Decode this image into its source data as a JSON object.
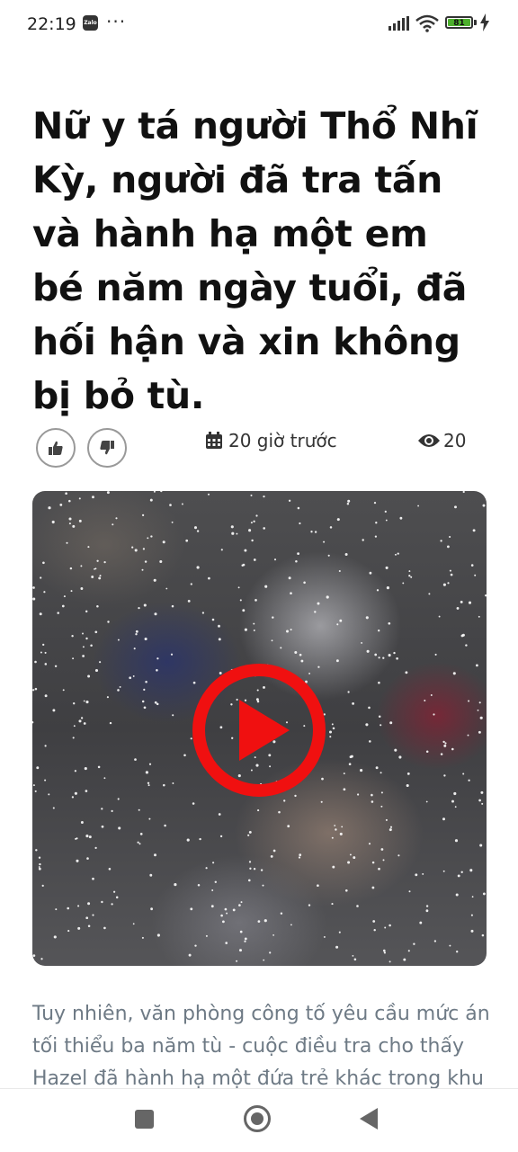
{
  "status_bar": {
    "time": "22:19",
    "notification_app": "Zalo",
    "more_dots": "···",
    "battery_level": "81"
  },
  "article": {
    "title": "Nữ y tá người Thổ Nhĩ Kỳ, người đã tra tấn và hành hạ một em bé năm ngày tuổi, đã hối hận và xin không bị bỏ tù.",
    "posted_ago": "20 giờ trước",
    "view_count": "20",
    "body_excerpt": "Tuy nhiên, văn phòng công tố yêu cầu mức án tối thiểu ba năm tù - cuộc điều tra cho thấy Hazel đã hành hạ một đứa trẻ khác trong khu"
  },
  "icons": {
    "like": "thumbs-up-icon",
    "dislike": "thumbs-down-icon",
    "date": "calendar-icon",
    "views": "eye-icon",
    "play": "play-icon"
  },
  "colors": {
    "play_accent": "#f01010",
    "body_text": "#6e7a85",
    "title_text": "#111111"
  }
}
